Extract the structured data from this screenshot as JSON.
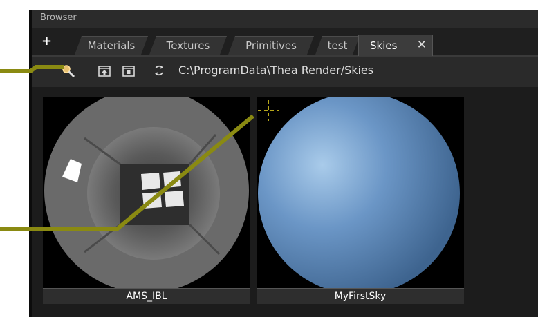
{
  "panel": {
    "title": "Browser"
  },
  "tabs": {
    "add_label": "+",
    "items": [
      {
        "label": "Materials"
      },
      {
        "label": "Textures"
      },
      {
        "label": "Primitives"
      },
      {
        "label": "test"
      },
      {
        "label": "Skies",
        "active": true
      }
    ],
    "close_label": "✕"
  },
  "toolbar": {
    "icons": [
      "search-icon",
      "folder-up-icon",
      "folder-icon",
      "refresh-icon"
    ],
    "path": "C:\\ProgramData\\Thea Render/Skies"
  },
  "thumbnails": [
    {
      "label": "AMS_IBL"
    },
    {
      "label": "MyFirstSky"
    }
  ],
  "colors": {
    "annotation": "#8a8a12",
    "panel_bg": "#242424",
    "sky_blue": "#5b86b8"
  }
}
